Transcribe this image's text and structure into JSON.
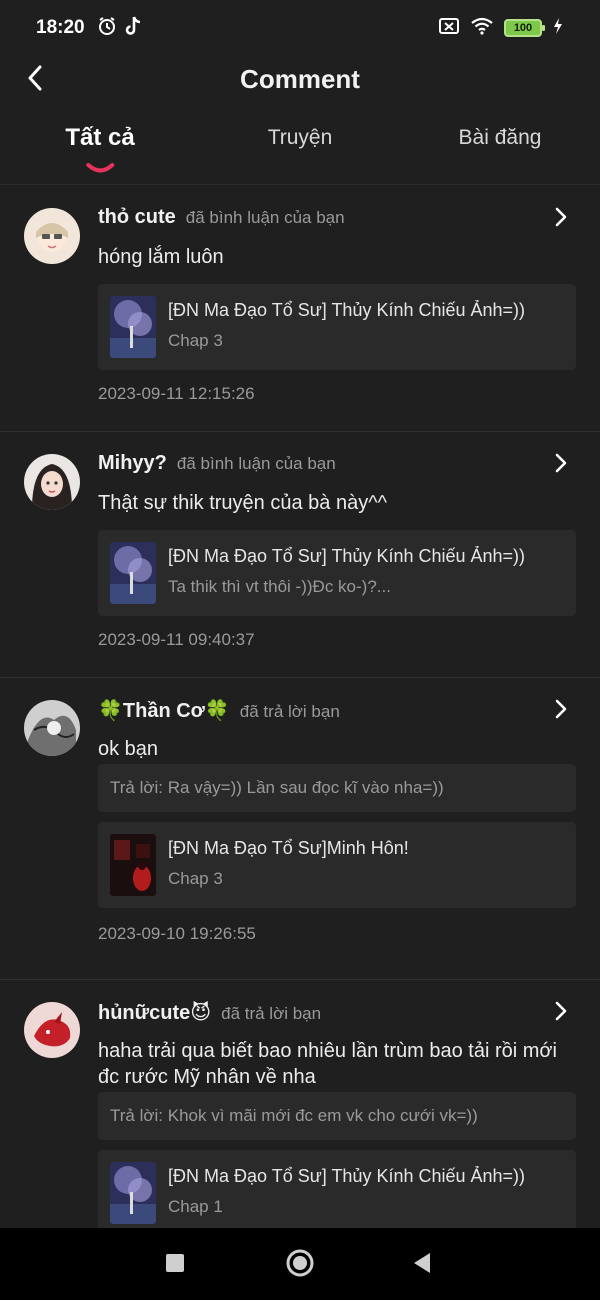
{
  "status_bar": {
    "time": "18:20",
    "battery": "100",
    "icons": [
      "alarm-icon",
      "tiktok-icon",
      "sim-off-icon",
      "wifi-icon",
      "charging-icon"
    ]
  },
  "header": {
    "title": "Comment",
    "back_icon": "chevron-left-icon"
  },
  "tabs": [
    {
      "label": "Tất cả",
      "active": true
    },
    {
      "label": "Truyện",
      "active": false
    },
    {
      "label": "Bài đăng",
      "active": false
    }
  ],
  "accent_color": "#e8335f",
  "notifications": [
    {
      "username": "thỏ cute",
      "action": "đã bình luận của bạn",
      "comment": "hóng lắm luôn",
      "reply": "",
      "story_title": "[ĐN Ma Đạo Tổ Sư] Thủy Kính Chiếu Ảnh=))",
      "story_sub": "Chap 3",
      "timestamp": "2023-09-11 12:15:26"
    },
    {
      "username": "Mihyy?",
      "action": "đã bình luận của bạn",
      "comment": "Thật sự thik truyện của bà này^^",
      "reply": "",
      "story_title": "[ĐN Ma Đạo Tổ Sư] Thủy Kính Chiếu Ảnh=))",
      "story_sub": "Ta thik thì vt thôi -))Đc ko-)?...",
      "timestamp": "2023-09-11 09:40:37"
    },
    {
      "username": "🍀Thần Cơ🍀",
      "action": "đã trả lời bạn",
      "comment": "ok bạn",
      "reply": "Trả lời: Ra vậy=)) Lần sau đọc kĩ vào nha=))",
      "story_title": "[ĐN Ma Đạo Tổ Sư]Minh Hôn!",
      "story_sub": "Chap 3",
      "timestamp": "2023-09-10 19:26:55"
    },
    {
      "username": "hủnữcute😈",
      "action": "đã trả lời bạn",
      "comment": "haha trải qua biết bao nhiêu lần trùm bao tải rồi mới đc rước Mỹ nhân về nha",
      "reply": "Trả lời: Khok vì mãi mới đc em vk cho cưới vk=))",
      "story_title": "[ĐN Ma Đạo Tổ Sư] Thủy Kính Chiếu Ảnh=))",
      "story_sub": "Chap 1",
      "timestamp": ""
    }
  ],
  "nav_icons": [
    "recent-apps-icon",
    "home-icon",
    "back-icon"
  ]
}
